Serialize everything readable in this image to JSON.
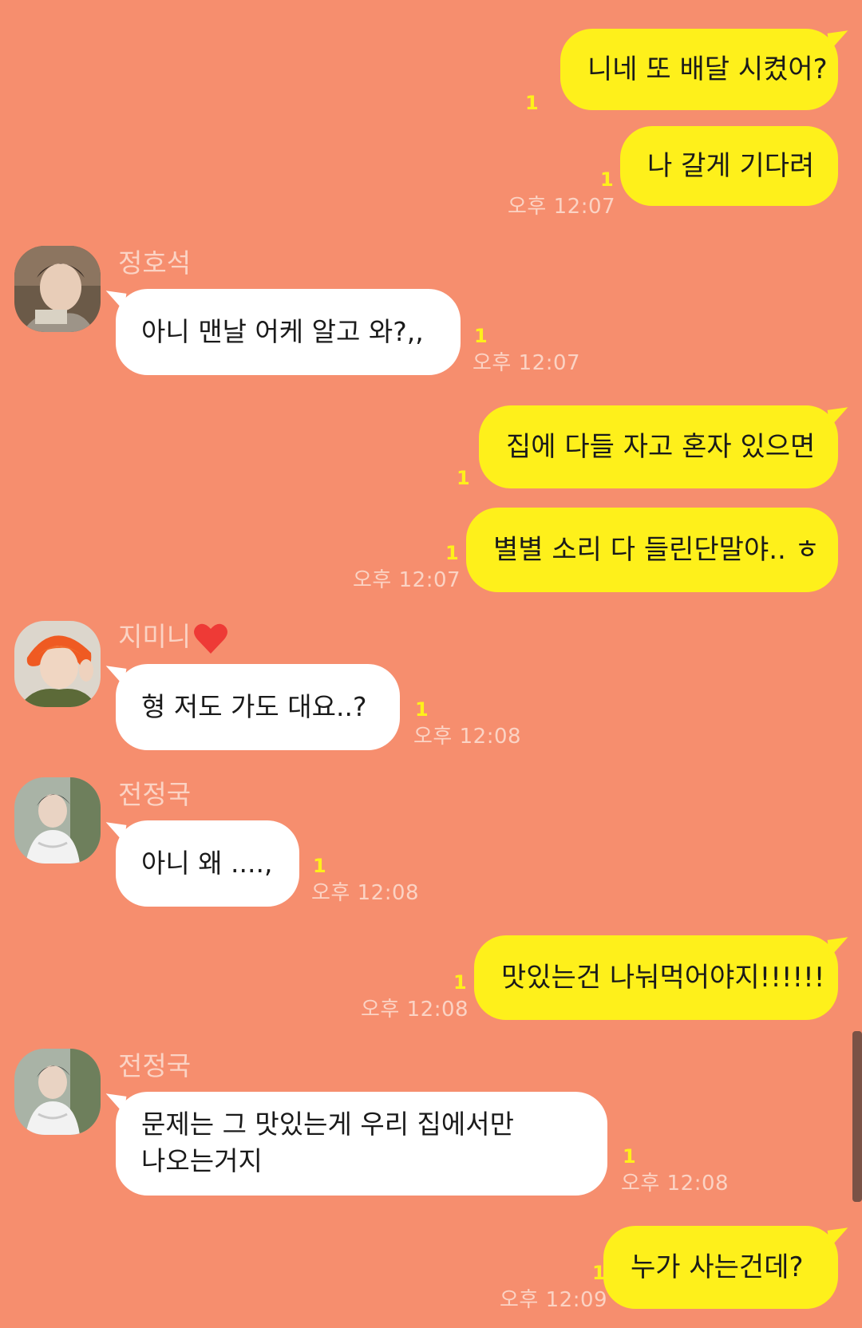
{
  "colors": {
    "background": "#F68E6E",
    "my_bubble": "#FEF01B",
    "their_bubble": "#FFFFFF",
    "unread_count": "#FEF01B",
    "timestamp": "#FBD3C4"
  },
  "messages": [
    {
      "from": "me",
      "text": "니네 또 배달 시켰어?",
      "unread": "1",
      "time": ""
    },
    {
      "from": "me",
      "text": "나 갈게 기다려",
      "unread": "1",
      "time": "오후 12:07"
    },
    {
      "from": "them",
      "sender": "정호석",
      "text": "아니 맨날 어케 알고 와?,,",
      "unread": "1",
      "time": "오후 12:07"
    },
    {
      "from": "me",
      "text": "집에 다들 자고 혼자 있으면",
      "unread": "1",
      "time": ""
    },
    {
      "from": "me",
      "text": "별별 소리 다 들린단말야.. ㅎ",
      "unread": "1",
      "time": "오후 12:07"
    },
    {
      "from": "them",
      "sender": "지미니",
      "sender_icon": "heart-icon",
      "text": "형 저도 가도 대요..?",
      "unread": "1",
      "time": "오후 12:08"
    },
    {
      "from": "them",
      "sender": "전정국",
      "text": "아니 왜 ....,",
      "unread": "1",
      "time": "오후 12:08"
    },
    {
      "from": "me",
      "text": "맛있는건 나눠먹어야지!!!!!!",
      "unread": "1",
      "time": "오후 12:08"
    },
    {
      "from": "them",
      "sender": "전정국",
      "text_lines": [
        "문제는 그 맛있는게 우리 집에서만",
        "나오는거지"
      ],
      "unread": "1",
      "time": "오후 12:08"
    },
    {
      "from": "me",
      "text": "누가 사는건데?",
      "unread": "1",
      "time": "오후 12:09"
    }
  ]
}
